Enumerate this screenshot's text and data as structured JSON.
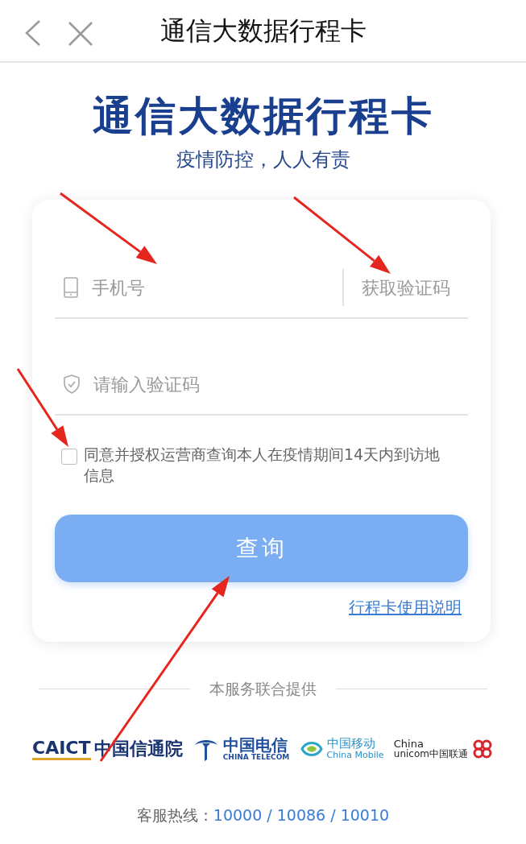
{
  "nav_bar": {
    "title": "通信大数据行程卡"
  },
  "hero": {
    "title": "通信大数据行程卡",
    "subtitle": "疫情防控，人人有责"
  },
  "form": {
    "phone_field": {
      "placeholder": "手机号"
    },
    "code_button": "获取验证码",
    "code_field": {
      "placeholder": "请输入验证码"
    },
    "consent": {
      "checked": false,
      "text": "同意并授权运营商查询本人在疫情期间14天内到访地信息"
    },
    "submit_button": "查询",
    "help_link": "行程卡使用说明"
  },
  "providers": {
    "heading": "本服务联合提供",
    "logos": [
      {
        "kind": "caict",
        "texts": [
          "CAICT",
          "中国信通院"
        ]
      },
      {
        "kind": "telecom",
        "texts": [
          "中国电信",
          "CHINA TELECOM"
        ]
      },
      {
        "kind": "mobile",
        "texts": [
          "中国移动",
          "China Mobile"
        ]
      },
      {
        "kind": "unicom",
        "texts": [
          "China",
          "unicom中国联通"
        ]
      }
    ]
  },
  "hotline": {
    "label": "客服热线：",
    "numbers": "10000 / 10086 / 10010"
  },
  "annotations": [
    {
      "kind": "arrow"
    },
    {
      "kind": "arrow"
    },
    {
      "kind": "arrow"
    },
    {
      "kind": "arrow"
    }
  ]
}
